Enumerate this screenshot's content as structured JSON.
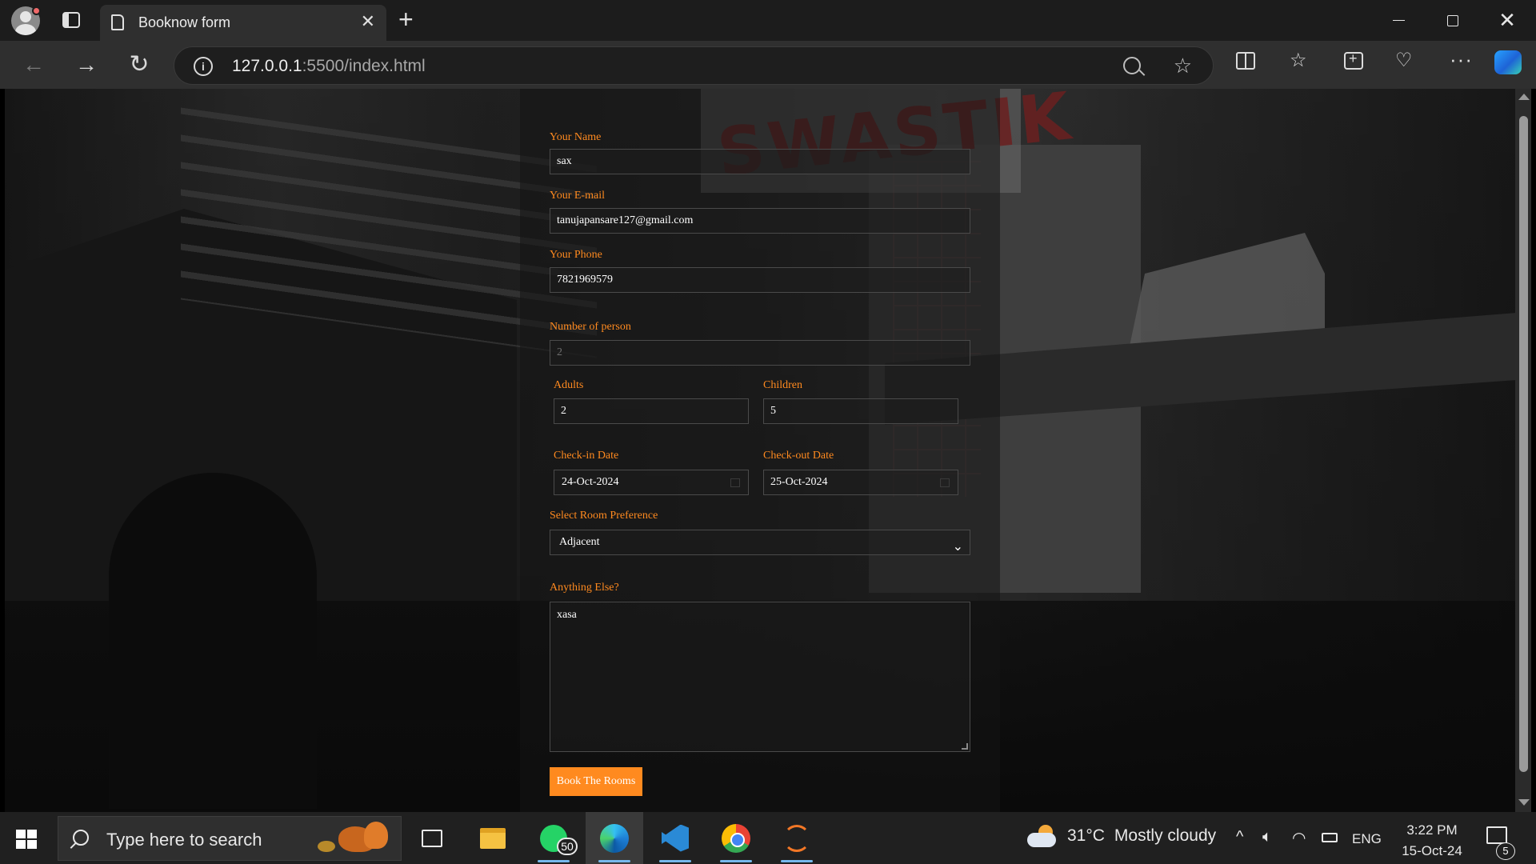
{
  "browser": {
    "tab_title": "Booknow form",
    "tab_close": "✕",
    "new_tab": "+",
    "url_host": "127.0.0.1",
    "url_rest": ":5500/index.html"
  },
  "form": {
    "name_label": "Your Name",
    "name_value": "sax",
    "email_label": "Your E-mail",
    "email_value": "tanujapansare127@gmail.com",
    "phone_label": "Your Phone",
    "phone_value": "7821969579",
    "persons_label": "Number of person",
    "persons_value": "2",
    "adults_label": "Adults",
    "adults_value": "2",
    "children_label": "Children",
    "children_value": "5",
    "checkin_label": "Check-in Date",
    "checkin_value": "24-Oct-2024",
    "checkout_label": "Check-out Date",
    "checkout_value": "25-Oct-2024",
    "room_label": "Select Room Preference",
    "room_value": "Adjacent",
    "notes_label": "Anything Else?",
    "notes_value": "xasa",
    "submit_label": "Book The Rooms"
  },
  "background_sign": "SWASTIK",
  "taskbar": {
    "search_placeholder": "Type here to search",
    "whatsapp_badge": "50",
    "weather_temp": "31°C",
    "weather_desc": "Mostly cloudy",
    "language": "ENG",
    "time": "3:22 PM",
    "date": "15-Oct-24",
    "notification_count": "5"
  },
  "colors": {
    "accent": "#ff8a1f",
    "tab_bar": "#1c1c1c",
    "toolbar": "#2f2f2f",
    "taskbar": "#202020"
  }
}
